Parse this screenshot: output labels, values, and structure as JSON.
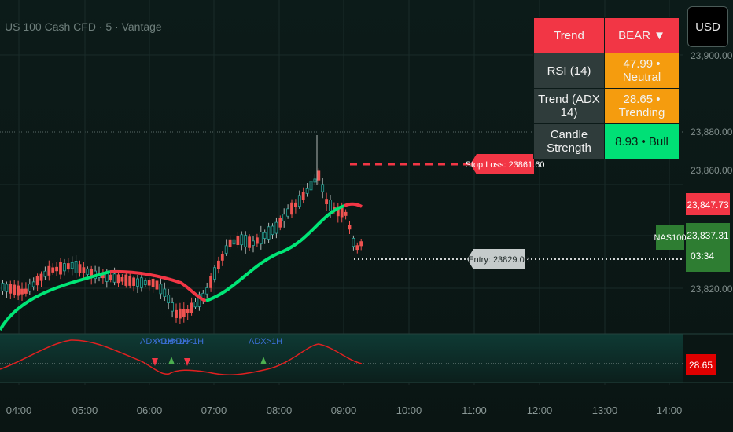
{
  "header": {
    "symbol_title": "US 100 Cash CFD · 5 · Vantage",
    "currency": "USD"
  },
  "info_table": {
    "rows": [
      {
        "label": "Trend",
        "value": "BEAR ▼",
        "label_color": "#f23645",
        "value_color": "#f23645"
      },
      {
        "label": "RSI (14)",
        "value": "47.99 • Neutral",
        "label_color": "#2f3c3b",
        "value_color": "#f59c0e"
      },
      {
        "label": "Trend (ADX 14)",
        "value": "28.65 • Trending",
        "label_color": "#2f3c3b",
        "value_color": "#f59c0e"
      },
      {
        "label": "Candle Strength",
        "value": "8.93 • Bull",
        "label_color": "#2f3c3b",
        "value_color": "#00e076"
      }
    ]
  },
  "price_axis": {
    "ticks": [
      "23,880.00",
      "23,860.00",
      "23,820.00"
    ],
    "partial_tick": "23,900.00",
    "high_label": "23,847.73",
    "current_price": "23,837.31",
    "countdown": "03:34",
    "symbol_tag": "NAS100"
  },
  "annotations": {
    "stop_loss": "Stop Loss: 23861.60",
    "entry": "Entry: 23829.06",
    "adx_labels": [
      "ADX<1H",
      "ADX>1H",
      "ADX<1H",
      "ADX>1H"
    ]
  },
  "indicator_pane": {
    "value_label": "28.65"
  },
  "time_axis": {
    "ticks": [
      "04:00",
      "05:00",
      "06:00",
      "07:00",
      "08:00",
      "09:00",
      "10:00",
      "11:00",
      "12:00",
      "13:00",
      "14:00"
    ]
  },
  "colors": {
    "bull": "#26a69a",
    "bear": "#ef5350",
    "ma_up": "#00e676",
    "ma_down": "#f23645",
    "adx_line": "#e02020"
  }
}
